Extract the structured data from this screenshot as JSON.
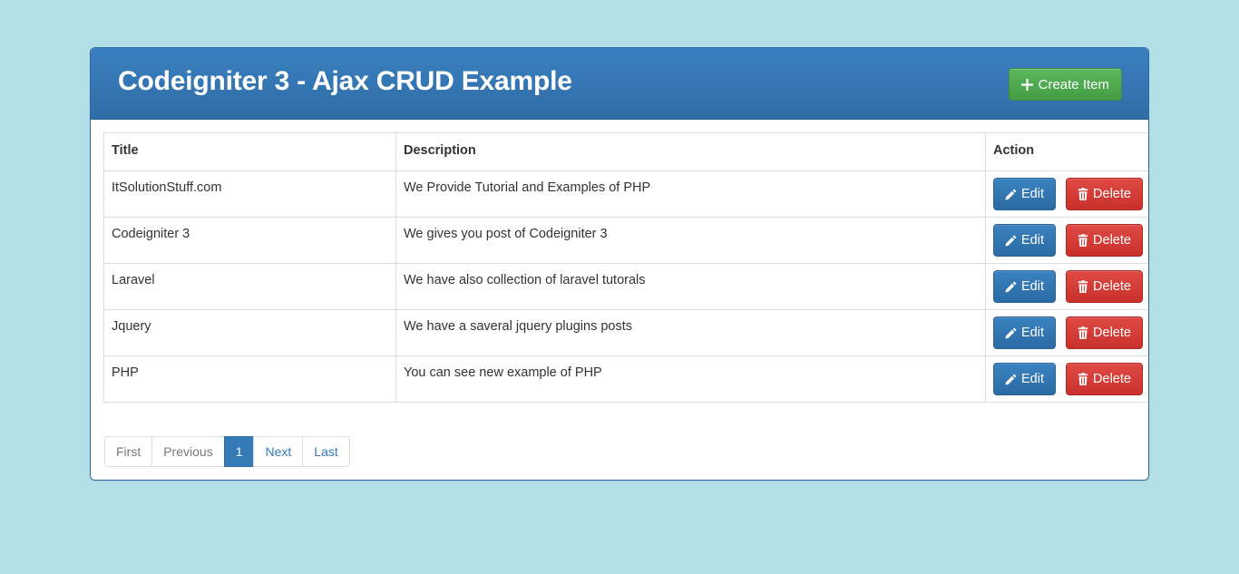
{
  "page": {
    "background_color": "#b3dfe7"
  },
  "panel": {
    "border_color": "#2c6ba5",
    "header": {
      "title": "Codeigniter 3 - Ajax CRUD Example",
      "gradient_from": "#3a80c0",
      "gradient_to": "#2f6da6",
      "create_button": {
        "label": "Create Item",
        "icon": "plus-icon",
        "glyph": "✚",
        "color": "#5cb85c"
      }
    },
    "table": {
      "columns": [
        "Title",
        "Description",
        "Action"
      ],
      "rows": [
        {
          "title": "ItSolutionStuff.com",
          "description": "We Provide Tutorial and Examples of PHP",
          "edit_label": "Edit",
          "delete_label": "Delete"
        },
        {
          "title": "Codeigniter 3",
          "description": "We gives you post of Codeigniter 3",
          "edit_label": "Edit",
          "delete_label": "Delete"
        },
        {
          "title": "Laravel",
          "description": "We have also collection of laravel tutorals",
          "edit_label": "Edit",
          "delete_label": "Delete"
        },
        {
          "title": "Jquery",
          "description": "We have a saveral jquery plugins posts",
          "edit_label": "Edit",
          "delete_label": "Delete"
        },
        {
          "title": "PHP",
          "description": "You can see new example of PHP",
          "edit_label": "Edit",
          "delete_label": "Delete"
        }
      ],
      "edit_button_color": "#2a6ba4",
      "delete_button_color": "#c9302c"
    },
    "pagination": {
      "items": [
        {
          "label": "First",
          "state": "disabled"
        },
        {
          "label": "Previous",
          "state": "disabled"
        },
        {
          "label": "1",
          "state": "active"
        },
        {
          "label": "Next",
          "state": "link"
        },
        {
          "label": "Last",
          "state": "link"
        }
      ],
      "active_color": "#337ab7",
      "link_color": "#337ab7",
      "disabled_color": "#777777"
    }
  }
}
